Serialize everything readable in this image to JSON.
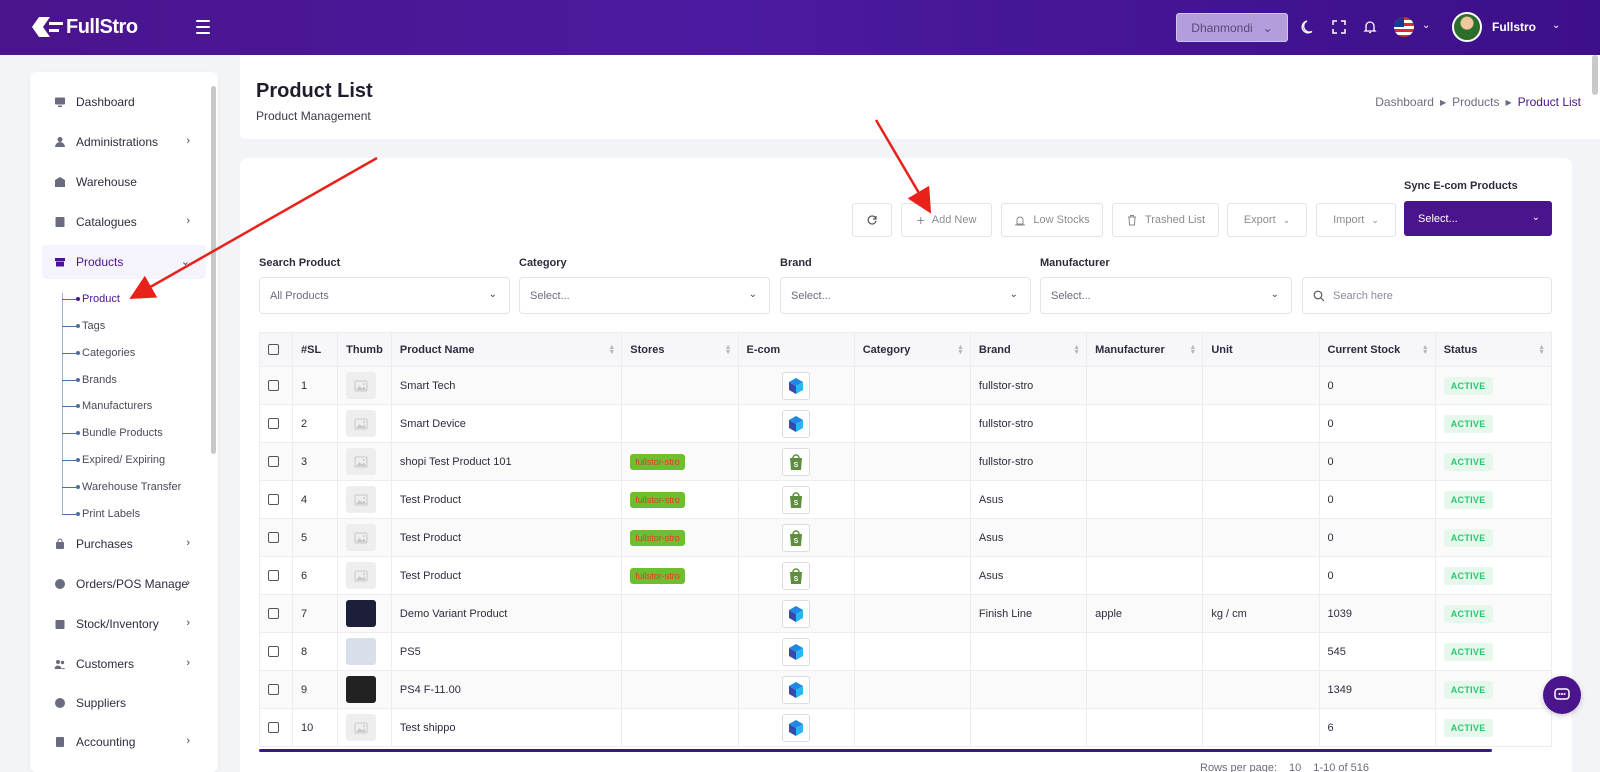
{
  "app": {
    "logo_text": "FullStro",
    "branch": "Dhanmondi",
    "username": "Fullstro"
  },
  "sidebar": {
    "items": [
      {
        "label": "Dashboard",
        "icon": "monitor-icon",
        "has_children": false
      },
      {
        "label": "Administrations",
        "icon": "user-icon",
        "has_children": true
      },
      {
        "label": "Warehouse",
        "icon": "warehouse-icon",
        "has_children": false
      },
      {
        "label": "Catalogues",
        "icon": "book-icon",
        "has_children": true
      },
      {
        "label": "Products",
        "icon": "products-icon",
        "has_children": true,
        "active": true
      },
      {
        "label": "Purchases",
        "icon": "bag-icon",
        "has_children": true
      },
      {
        "label": "Orders/POS Manage",
        "icon": "cart-icon",
        "has_children": true
      },
      {
        "label": "Stock/Inventory",
        "icon": "box-icon",
        "has_children": true
      },
      {
        "label": "Customers",
        "icon": "users-icon",
        "has_children": true
      },
      {
        "label": "Suppliers",
        "icon": "truck-icon",
        "has_children": false
      },
      {
        "label": "Accounting",
        "icon": "calculator-icon",
        "has_children": true
      }
    ],
    "product_sub_items": [
      "Product",
      "Tags",
      "Categories",
      "Brands",
      "Manufacturers",
      "Bundle Products",
      "Expired/ Expiring",
      "Warehouse Transfer",
      "Print Labels"
    ]
  },
  "header": {
    "title": "Product List",
    "subtitle": "Product Management",
    "breadcrumb": [
      "Dashboard",
      "Products",
      "Product List"
    ]
  },
  "toolbar": {
    "add_new": "Add New",
    "low_stocks": "Low Stocks",
    "trashed_list": "Trashed List",
    "export": "Export",
    "import": "Import",
    "sync_label": "Sync E-com Products",
    "sync_value": "Select..."
  },
  "filters": {
    "search_product": {
      "label": "Search Product",
      "value": "All Products"
    },
    "category": {
      "label": "Category",
      "value": "Select..."
    },
    "brand": {
      "label": "Brand",
      "value": "Select..."
    },
    "manufacturer": {
      "label": "Manufacturer",
      "value": "Select..."
    },
    "search_placeholder": "Search here"
  },
  "table": {
    "columns": [
      "#SL",
      "Thumb",
      "Product Name",
      "Stores",
      "E-com",
      "Category",
      "Brand",
      "Manufacturer",
      "Unit",
      "Current Stock",
      "Status"
    ],
    "rows": [
      {
        "sl": "1",
        "thumb": "placeholder",
        "name": "Smart Tech",
        "store": "",
        "ecom": "ecom-cube",
        "category": "",
        "brand": "fullstor-stro",
        "manufacturer": "",
        "unit": "",
        "stock": "0",
        "status": "ACTIVE"
      },
      {
        "sl": "2",
        "thumb": "placeholder",
        "name": "Smart Device",
        "store": "",
        "ecom": "ecom-cube",
        "category": "",
        "brand": "fullstor-stro",
        "manufacturer": "",
        "unit": "",
        "stock": "0",
        "status": "ACTIVE"
      },
      {
        "sl": "3",
        "thumb": "placeholder",
        "name": "shopi Test Product 101",
        "store": "fullstor-stro",
        "ecom": "shopify",
        "category": "",
        "brand": "fullstor-stro",
        "manufacturer": "",
        "unit": "",
        "stock": "0",
        "status": "ACTIVE"
      },
      {
        "sl": "4",
        "thumb": "placeholder",
        "name": "Test Product",
        "store": "fullstor-stro",
        "ecom": "shopify",
        "category": "",
        "brand": "Asus",
        "manufacturer": "",
        "unit": "",
        "stock": "0",
        "status": "ACTIVE"
      },
      {
        "sl": "5",
        "thumb": "placeholder",
        "name": "Test Product",
        "store": "fullstor-stro",
        "ecom": "shopify",
        "category": "",
        "brand": "Asus",
        "manufacturer": "",
        "unit": "",
        "stock": "0",
        "status": "ACTIVE"
      },
      {
        "sl": "6",
        "thumb": "placeholder",
        "name": "Test Product",
        "store": "fullstor-stro",
        "ecom": "shopify",
        "category": "",
        "brand": "Asus",
        "manufacturer": "",
        "unit": "",
        "stock": "0",
        "status": "ACTIVE"
      },
      {
        "sl": "7",
        "thumb": "dark",
        "name": "Demo Variant Product",
        "store": "",
        "ecom": "ecom-cube",
        "category": "",
        "brand": "Finish Line",
        "manufacturer": "apple",
        "unit": "kg / cm",
        "stock": "1039",
        "status": "ACTIVE"
      },
      {
        "sl": "8",
        "thumb": "ps5",
        "name": "PS5",
        "store": "",
        "ecom": "ecom-cube",
        "category": "",
        "brand": "",
        "manufacturer": "",
        "unit": "",
        "stock": "545",
        "status": "ACTIVE"
      },
      {
        "sl": "9",
        "thumb": "ps4",
        "name": "PS4 F-11.00",
        "store": "",
        "ecom": "ecom-cube",
        "category": "",
        "brand": "",
        "manufacturer": "",
        "unit": "",
        "stock": "1349",
        "status": "ACTIVE"
      },
      {
        "sl": "10",
        "thumb": "placeholder",
        "name": "Test shippo",
        "store": "",
        "ecom": "ecom-cube",
        "category": "",
        "brand": "",
        "manufacturer": "",
        "unit": "",
        "stock": "6",
        "status": "ACTIVE"
      }
    ]
  },
  "pagination": {
    "rows_per_page_label": "Rows per page:",
    "rows_per_page": "10",
    "range": "1-10 of 516"
  },
  "colors": {
    "primary": "#4a148c",
    "status_active_bg": "#e6f7ec",
    "status_active_text": "#28c76f",
    "store_badge_bg": "#6cbf2f",
    "annotation_arrow": "#e8221b"
  }
}
